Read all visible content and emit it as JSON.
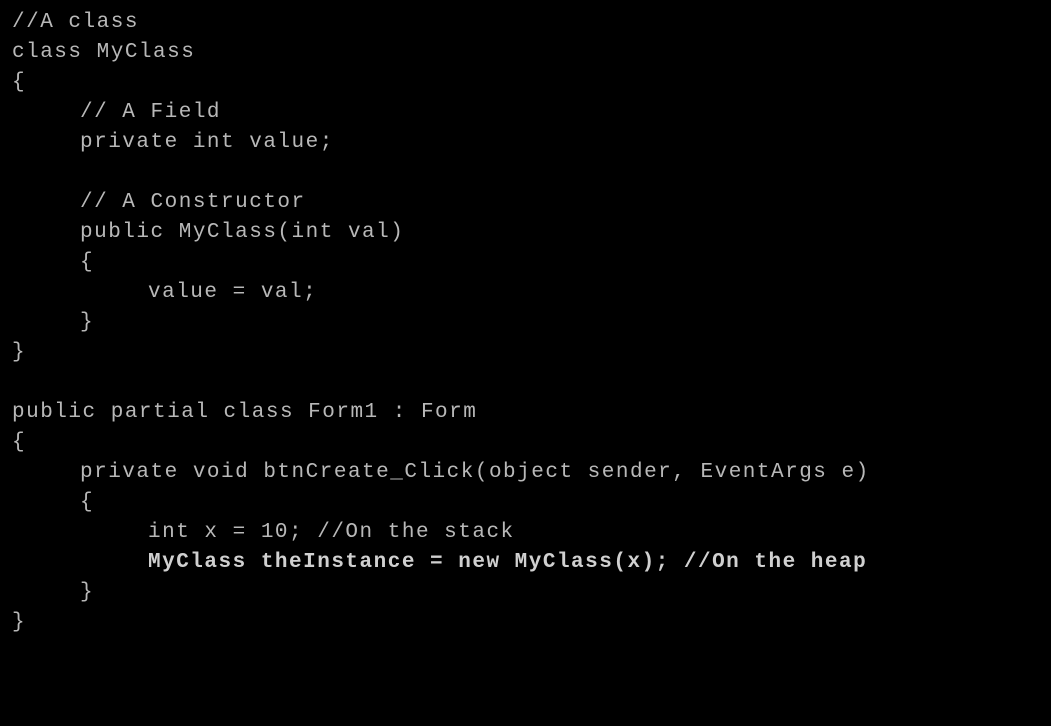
{
  "lines": {
    "l0": "//A class",
    "l1": "class MyClass",
    "l2": "{",
    "l3": "// A Field",
    "l4": "private int value;",
    "l5": "",
    "l6": "// A Constructor",
    "l7": "public MyClass(int val)",
    "l8": "{",
    "l9": "value = val;",
    "l10": "}",
    "l11": "}",
    "l12": "",
    "l13": "public partial class Form1 : Form",
    "l14": "{",
    "l15": "private void btnCreate_Click(object sender, EventArgs e)",
    "l16": "{",
    "l17": "int x = 10; //On the stack",
    "l18": "MyClass theInstance = new MyClass(x); //On the heap",
    "l19": "}",
    "l20": "}"
  }
}
